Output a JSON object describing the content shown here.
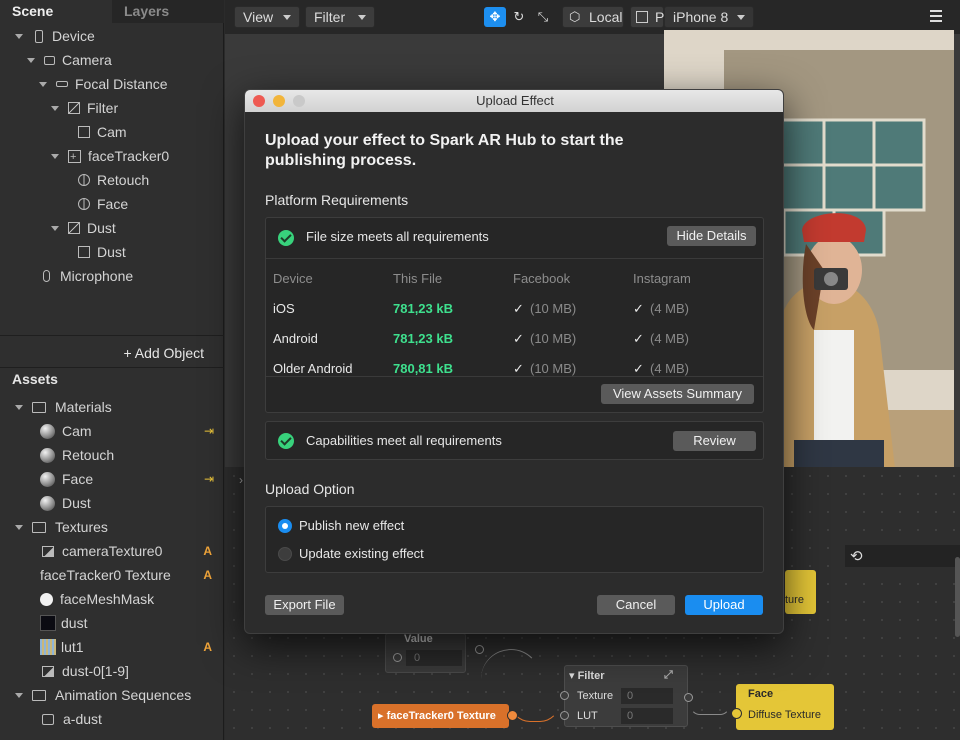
{
  "tabs": {
    "scene": "Scene",
    "layers": "Layers"
  },
  "scene_tree": [
    {
      "label": "Device",
      "icon": "device-icon"
    },
    {
      "label": "Camera",
      "icon": "camera-icon"
    },
    {
      "label": "Focal Distance",
      "icon": "focal-distance-icon"
    },
    {
      "label": "Filter",
      "icon": "filter-icon"
    },
    {
      "label": "Cam",
      "icon": "rectangle-icon"
    },
    {
      "label": "faceTracker0",
      "icon": "face-tracker-icon"
    },
    {
      "label": "Retouch",
      "icon": "face-mesh-icon"
    },
    {
      "label": "Face",
      "icon": "face-mesh-icon"
    },
    {
      "label": "Dust",
      "icon": "filter-icon"
    },
    {
      "label": "Dust",
      "icon": "rectangle-icon"
    },
    {
      "label": "Microphone",
      "icon": "microphone-icon"
    }
  ],
  "add_object": "+ Add Object",
  "assets_title": "Assets",
  "assets_tree": [
    {
      "label": "Materials",
      "icon": "folder-icon"
    },
    {
      "label": "Cam",
      "icon": "material-sphere-icon",
      "badge": "⇥"
    },
    {
      "label": "Retouch",
      "icon": "material-sphere-icon"
    },
    {
      "label": "Face",
      "icon": "material-sphere-icon",
      "badge": "⇥"
    },
    {
      "label": "Dust",
      "icon": "material-sphere-icon"
    },
    {
      "label": "Textures",
      "icon": "folder-icon"
    },
    {
      "label": "cameraTexture0",
      "icon": "image-icon",
      "badge": "A"
    },
    {
      "label": "faceTracker0 Texture",
      "icon": "",
      "badge": "A"
    },
    {
      "label": "faceMeshMask",
      "icon": "white-circle-icon"
    },
    {
      "label": "dust",
      "icon": "dust-texture-icon"
    },
    {
      "label": "lut1",
      "icon": "lut-texture-icon",
      "badge": "A"
    },
    {
      "label": "dust-0[1-9]",
      "icon": "image-icon"
    },
    {
      "label": "Animation Sequences",
      "icon": "folder-icon"
    },
    {
      "label": "a-dust",
      "icon": "sequence-icon"
    }
  ],
  "toolbar": {
    "view": "View",
    "filter": "Filter",
    "local": "Local",
    "p": "P",
    "device": "iPhone 8"
  },
  "dialog": {
    "title": "Upload Effect",
    "heading": "Upload your effect to Spark AR Hub to start the publishing process.",
    "platform_requirements": "Platform Requirements",
    "file_size_ok": "File size meets all requirements",
    "hide_details": "Hide Details",
    "columns": [
      "Device",
      "This File",
      "Facebook",
      "Instagram"
    ],
    "rows": [
      {
        "device": "iOS",
        "size": "781,23 kB",
        "facebook": "(10 MB)",
        "instagram": "(4 MB)"
      },
      {
        "device": "Android",
        "size": "781,23 kB",
        "facebook": "(10 MB)",
        "instagram": "(4 MB)"
      },
      {
        "device": "Older Android",
        "size": "780,81 kB",
        "facebook": "(10 MB)",
        "instagram": "(4 MB)"
      }
    ],
    "check_mark": "✓",
    "view_assets_summary": "View Assets Summary",
    "capabilities_ok": "Capabilities meet all requirements",
    "review": "Review",
    "upload_option": "Upload Option",
    "publish_new": "Publish new effect",
    "update_existing": "Update existing effect",
    "export_file": "Export File",
    "cancel": "Cancel",
    "upload": "Upload"
  },
  "patch": {
    "value_title": "Value",
    "value_field": "0",
    "filter_title": "Filter",
    "texture_label": "Texture",
    "texture_value": "0",
    "lut_label": "LUT",
    "lut_value": "0",
    "face_tracker_texture": "faceTracker0 Texture",
    "face_title": "Face",
    "diffuse_texture": "Diffuse Texture",
    "partial_texture": "ture"
  },
  "colors": {
    "accent_blue": "#1a8df0",
    "success_green": "#3ee08e",
    "badge_orange": "#f0a53a",
    "patch_yellow": "#e4c637",
    "patch_orange": "#d9712a"
  }
}
